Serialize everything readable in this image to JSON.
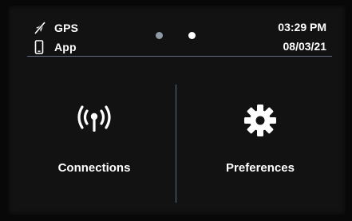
{
  "status": {
    "gps_label": "GPS",
    "app_label": "App",
    "time": "03:29 PM",
    "date": "08/03/21",
    "gps_icon": "gps-off-icon",
    "app_icon": "phone-icon"
  },
  "pager": {
    "page_count": 2,
    "active_page": 2
  },
  "tiles": [
    {
      "label": "Connections",
      "icon": "antenna-signal-icon"
    },
    {
      "label": "Preferences",
      "icon": "gear-icon"
    }
  ],
  "colors": {
    "background": "#121212",
    "text": "#ffffff",
    "divider": "#5d6f80",
    "dot_inactive": "#8e9aa6",
    "dot_active": "#ffffff"
  }
}
